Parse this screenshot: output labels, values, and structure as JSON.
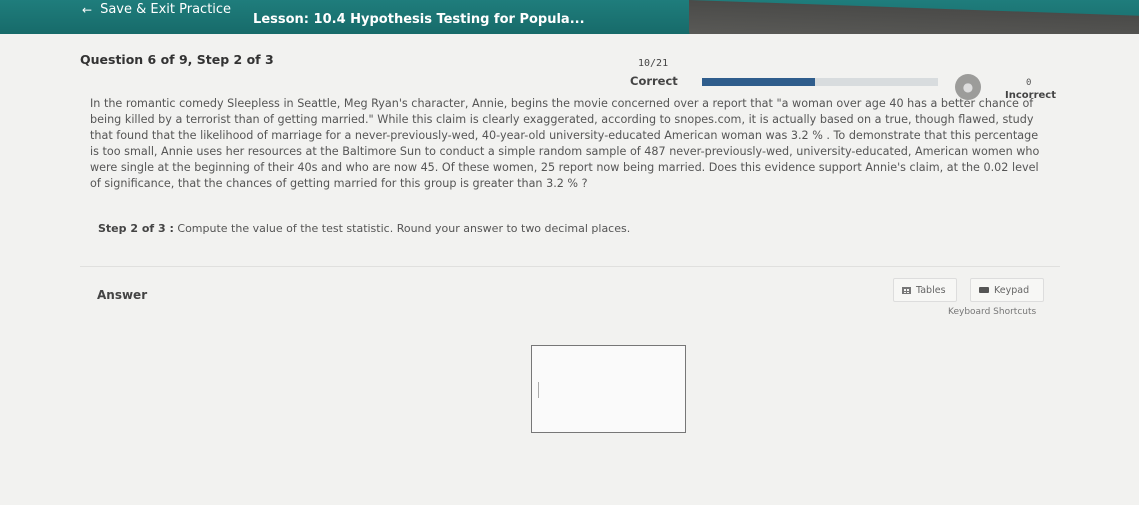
{
  "header": {
    "save_exit_label": "Save & Exit Practice",
    "lesson_title": "Lesson: 10.4 Hypothesis Testing for Popula..."
  },
  "question": {
    "number_label": "Question 6 of 9,",
    "step_label": "Step 2 of 3",
    "text": "In the romantic comedy Sleepless in Seattle, Meg Ryan's character, Annie, begins the movie concerned over a report that \"a woman over age 40 has a better chance of being killed by a terrorist than of getting married.\" While this claim is clearly exaggerated, according to snopes.com, it is actually based on a true, though flawed, study that found that the likelihood of marriage for a never-previously-wed, 40-year-old university-educated American woman was 3.2 % . To demonstrate that this percentage is too small, Annie uses her resources at the Baltimore Sun to conduct a simple random sample of 487 never-previously-wed, university-educated, American women who were single at the beginning of their 40s and who are now 45. Of these women, 25 report now being married. Does this evidence support Annie's claim, at the 0.02 level of significance, that the chances of getting married for this group is greater than 3.2 % ?",
    "step_prompt_label": "Step 2 of 3 :",
    "step_prompt_text": "Compute the value of the test statistic. Round your answer to two decimal places."
  },
  "score": {
    "fraction": "10/21",
    "correct_label": "Correct",
    "progress": 0.48,
    "incorrect_count": "0",
    "incorrect_label": "Incorrect"
  },
  "answer": {
    "label": "Answer",
    "tables_label": "Tables",
    "keypad_label": "Keypad",
    "shortcuts_label": "Keyboard Shortcuts",
    "value": ""
  },
  "colors": {
    "header": "#1f7d7c",
    "progress": "#2f5d8c",
    "panel": "#f2f2f0"
  },
  "icons": {
    "back": "back-arrow-icon",
    "tables": "table-icon",
    "keypad": "keypad-icon",
    "coin": "coin-icon"
  }
}
